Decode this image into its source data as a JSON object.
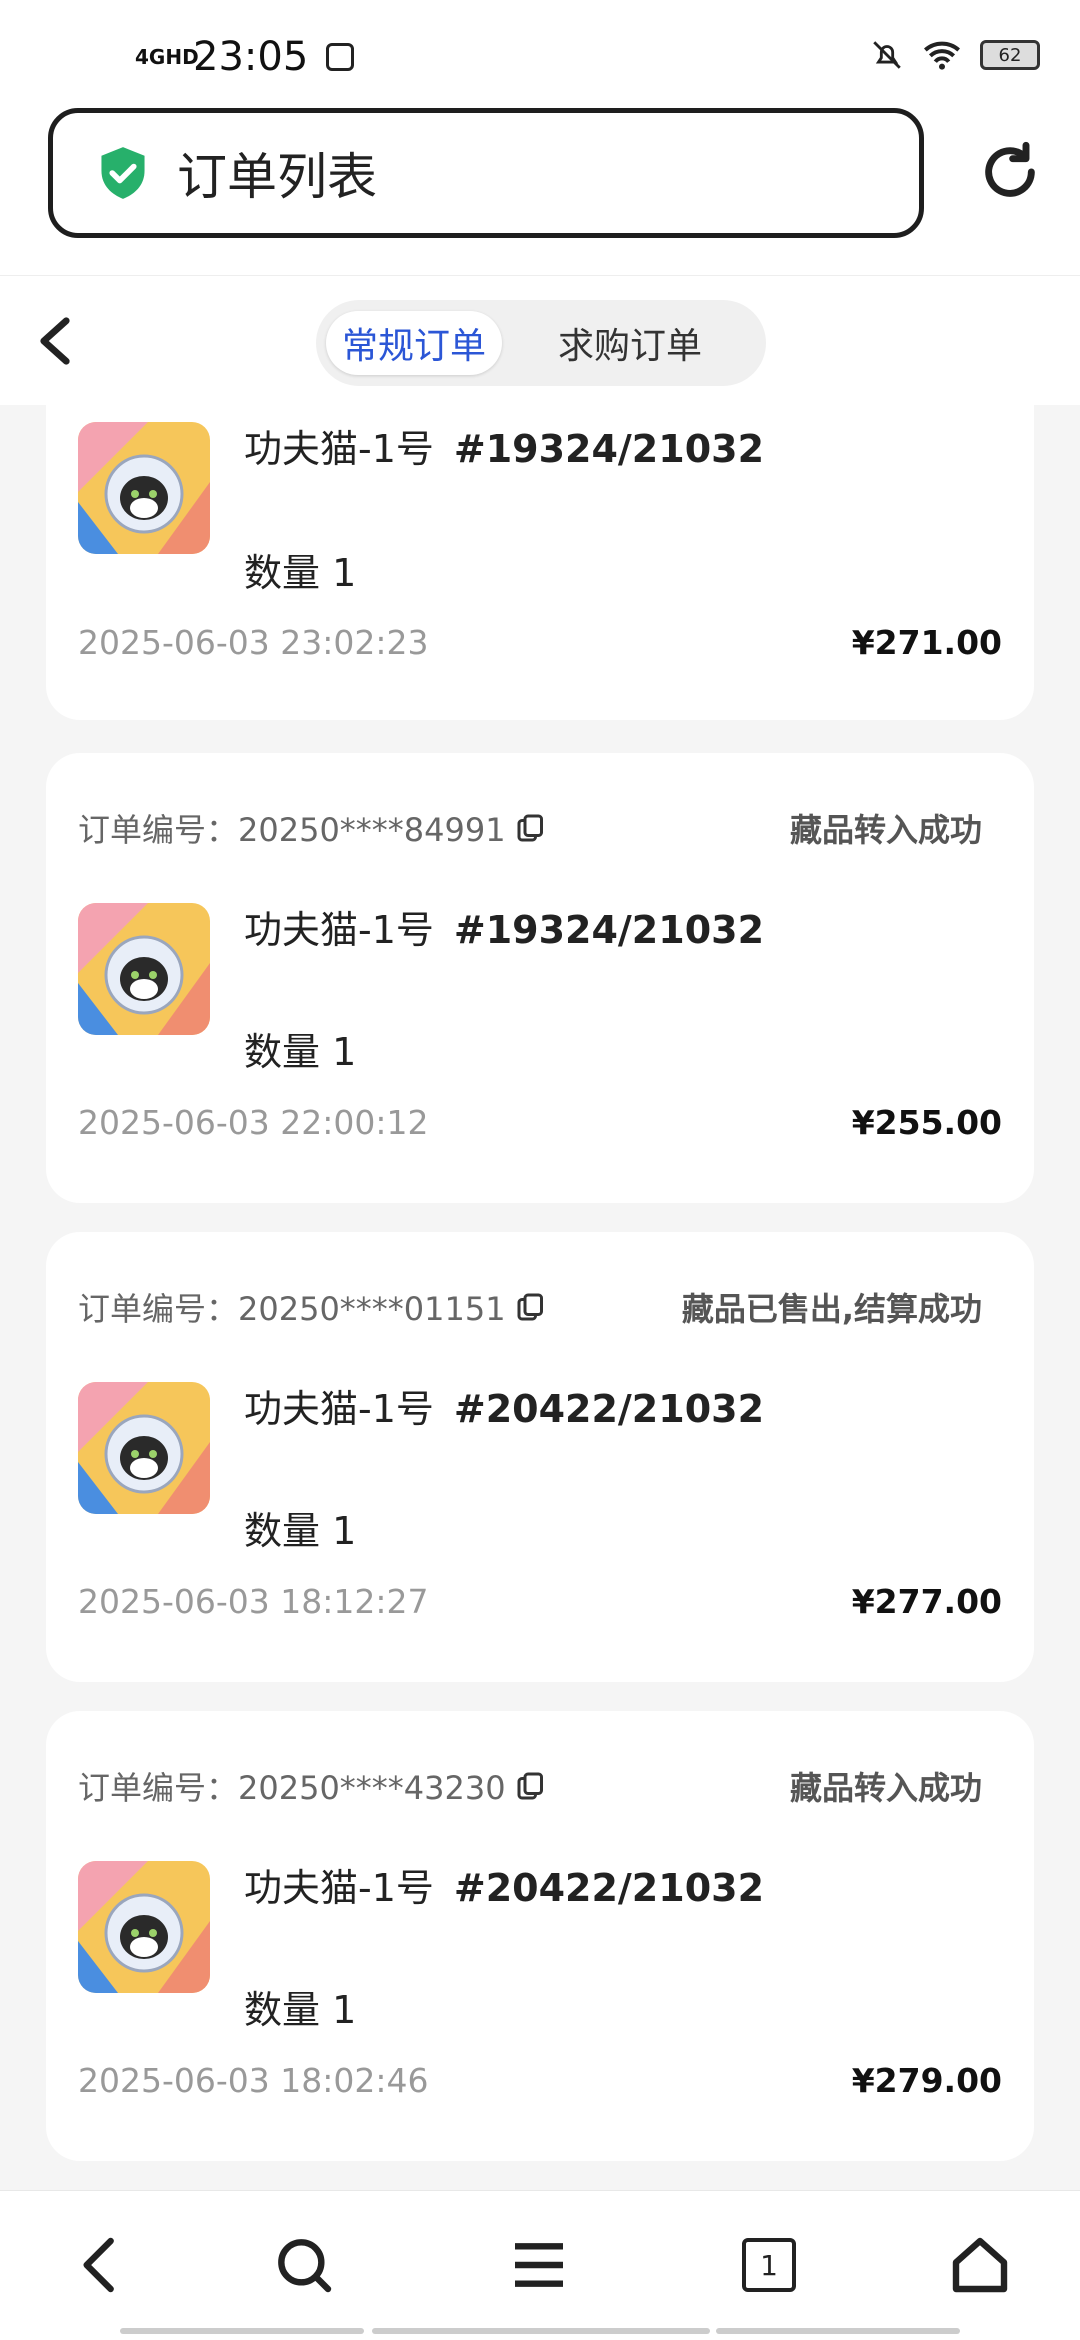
{
  "status_bar": {
    "network": "4GHD",
    "time": "23:05",
    "battery": "62"
  },
  "browser": {
    "url_title": "订单列表"
  },
  "tabs": [
    {
      "label": "常规订单"
    },
    {
      "label": "求购订单"
    }
  ],
  "orders": [
    {
      "order_no": "",
      "status": "",
      "product": "功夫猫-1号",
      "serial": "#19324/21032",
      "qty": "数量 1",
      "datetime": "2025-06-03 23:02:23",
      "price": "¥271.00"
    },
    {
      "order_no": "订单编号：20250****84991",
      "status": "藏品转入成功",
      "product": "功夫猫-1号",
      "serial": "#19324/21032",
      "qty": "数量 1",
      "datetime": "2025-06-03 22:00:12",
      "price": "¥255.00"
    },
    {
      "order_no": "订单编号：20250****01151",
      "status": "藏品已售出,结算成功",
      "product": "功夫猫-1号",
      "serial": "#20422/21032",
      "qty": "数量 1",
      "datetime": "2025-06-03 18:12:27",
      "price": "¥277.00"
    },
    {
      "order_no": "订单编号：20250****43230",
      "status": "藏品转入成功",
      "product": "功夫猫-1号",
      "serial": "#20422/21032",
      "qty": "数量 1",
      "datetime": "2025-06-03 18:02:46",
      "price": "¥279.00"
    }
  ],
  "bottom_nav": {
    "tab_count": "1"
  },
  "colors": {
    "accent": "#2b56d6",
    "shield": "#27b06b"
  }
}
